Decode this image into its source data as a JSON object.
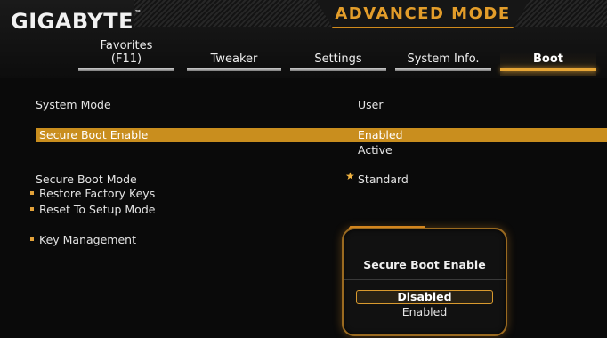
{
  "brand": {
    "logo": "GIGABYTE",
    "tm": "™"
  },
  "mode_title": "ADVANCED MODE",
  "tabs": [
    {
      "label": "Favorites\n(F11)",
      "active": false
    },
    {
      "label": "Tweaker",
      "active": false
    },
    {
      "label": "Settings",
      "active": false
    },
    {
      "label": "System Info.",
      "active": false
    },
    {
      "label": "Boot",
      "active": true
    }
  ],
  "settings": {
    "system_mode": {
      "label": "System Mode",
      "value": "User"
    },
    "secure_boot_enable": {
      "label": "Secure Boot Enable",
      "value": "Enabled",
      "status": "Active"
    },
    "secure_boot_mode": {
      "label": "Secure Boot Mode",
      "value": "Standard"
    },
    "restore_factory_keys": {
      "label": "Restore Factory Keys"
    },
    "reset_to_setup_mode": {
      "label": "Reset To Setup Mode"
    },
    "key_management": {
      "label": "Key Management"
    }
  },
  "popup": {
    "title": "Secure Boot Enable",
    "options": [
      "Disabled",
      "Enabled"
    ],
    "selected": "Disabled"
  },
  "colors": {
    "accent": "#c98e1e",
    "mode_title": "#e39d2a",
    "background": "#0a0a0a"
  },
  "icons": {
    "star": "star-icon",
    "bullet": "bullet-icon"
  }
}
